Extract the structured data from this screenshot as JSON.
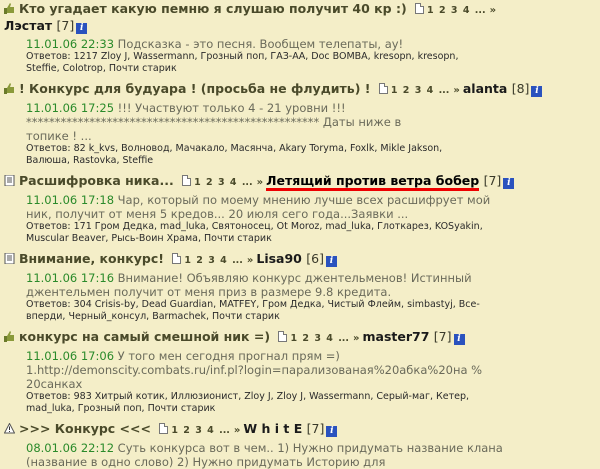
{
  "topics": [
    {
      "title": "Кто угадает какую пемню я слушаю получит 40 кр :)",
      "icon": "thumb-icon",
      "pages": [
        "1",
        "2",
        "3",
        "4",
        "..."
      ],
      "arrow": "»",
      "author": "Лэстат",
      "count": "[7]",
      "date": "11.01.06 22:33",
      "text_lines": [
        "Подсказка - это песня. Вообщем телепаты, ау!"
      ],
      "answers_label": "Ответов: 1217",
      "answers_lines": [
        "Zloy J, Wassermann, Грозный поп, ГАЗ-АА, Doc BOMBA, kresopn, kresopn,",
        "Steffie, Colotrop, Почти старик"
      ]
    },
    {
      "title": "! Конкурс для будуара ! (просьба не флудить) !",
      "icon": "thumb-icon",
      "pages": [
        "1",
        "2",
        "3",
        "4",
        "..."
      ],
      "arrow": "»",
      "author": "alanta",
      "count": "[8]",
      "date": "11.01.06 17:25",
      "text_lines": [
        "!!! Участвуют только 4 - 21 уровни !!!",
        "*************************************************** Даты ниже в",
        "топике ! ..."
      ],
      "answers_label": "Ответов: 82",
      "answers_lines": [
        "k_kvs, Волновод, Мачакало, Масянча, Akary Toryma, Foxlk, Mikle Jakson,",
        "Валюша, Rastovka, Steffie"
      ]
    },
    {
      "title": "Расшифровка ника...",
      "icon": "doc-icon",
      "pages": [
        "1",
        "2",
        "3",
        "4",
        "..."
      ],
      "arrow": "»",
      "author": "Летящий против ветра бобер",
      "count": "[7]",
      "date": "11.01.06 17:18",
      "text_lines": [
        "Чар, который по моему мнению лучше всех расшифрует мой",
        "ник, получит от меня 5 кредов... 20 июля сего года...Заявки ..."
      ],
      "answers_label": "Ответов: 171",
      "answers_lines": [
        "Гром Дедка, mad_luka, Святоносец, Ot Moroz, mad_luka, Глоткарез, KOSyakin,",
        "Muscular Beaver, Рысь-Воин Храма, Почти старик"
      ]
    },
    {
      "title": "Внимание, конкурс!",
      "icon": "doc-icon",
      "pages": [
        "1",
        "2",
        "3",
        "4",
        "..."
      ],
      "arrow": "»",
      "author": "Lisa90",
      "count": "[6]",
      "date": "11.01.06 17:16",
      "text_lines": [
        "Внимание! Объявляю конкурс джентельменов! Истинный",
        "джентельмен получит от меня приз в размере 9.8 кредита."
      ],
      "answers_label": "Ответов: 304",
      "answers_lines": [
        "Crisis-by, Dead Guardian, MATFEY, Гром Дедка, Чистый Флейм, simbastyj, Все-",
        "вперди, Черный_консул, Barmachek, Почти старик"
      ]
    },
    {
      "title": "конкурс на самый смешной ник =)",
      "icon": "thumb-icon",
      "pages": [
        "1",
        "2",
        "3",
        "4",
        "..."
      ],
      "arrow": "»",
      "author": "master77",
      "count": "[7]",
      "date": "11.01.06 17:06",
      "text_lines": [
        "У того мен сегодня прогнал прям =)",
        "1.http://demonscity.combats.ru/inf.pl?login=парализованая%20абка%20на %",
        "20санках"
      ],
      "answers_label": "Ответов: 983",
      "answers_lines": [
        "Хитрый котик, Иллюзионист, Zloy J, Zloy J, Wassermann, Серый-маг, Кетер,",
        "mad_luka, Грозный поп, Почти старик"
      ]
    },
    {
      "title": ">>> Конкурс <<<",
      "icon": "warning-icon",
      "pages": [
        "1",
        "2",
        "3",
        "4",
        "..."
      ],
      "arrow": "»",
      "author": "W h i t E",
      "count": "[7]",
      "date": "08.01.06 22:12",
      "text_lines": [
        "Суть конкурса вот в чем.. 1) Нужно придумать название клана",
        "(название в одно слово) 2) Нужно придумать Историю для"
      ],
      "answers_label": "",
      "answers_lines": []
    }
  ],
  "colors": {
    "background": "#f4eec8",
    "date": "#2a8a2a",
    "info_badge": "#2a52be",
    "highlight_underline": "#e00000"
  },
  "info_badge_text": "i"
}
